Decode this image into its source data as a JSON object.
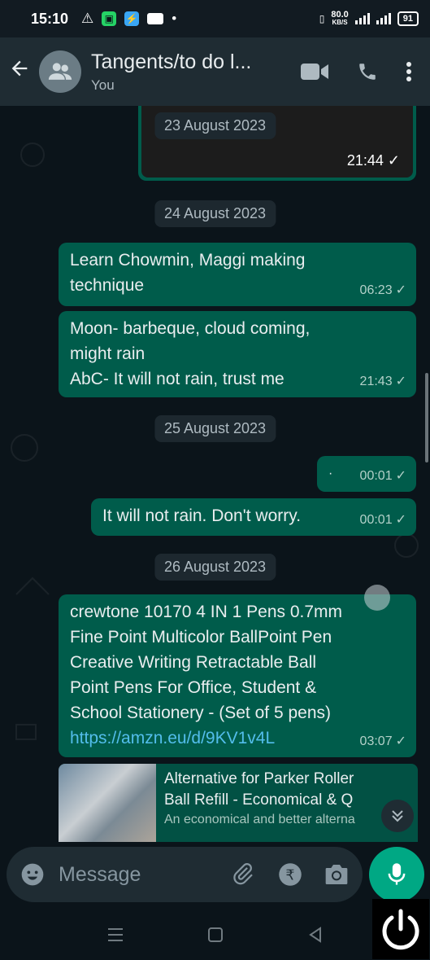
{
  "status_bar": {
    "time": "15:10",
    "speed": "80.0",
    "speed_unit": "KB/S",
    "battery": "91"
  },
  "header": {
    "title": "Tangents/to do l...",
    "subtitle": "You"
  },
  "messages": {
    "m0_time": "21:44",
    "date1": "23 August 2023",
    "date2": "24 August 2023",
    "m1_line1": "Learn Chowmin, Maggi making",
    "m1_line2": "technique",
    "m1_time": "06:23",
    "m2_line1": "Moon- barbeque, cloud coming,",
    "m2_line2": "might rain",
    "m2_line3": "AbC- It will not rain, trust me",
    "m2_time": "21:43",
    "date3": "25 August 2023",
    "m3_text": "·",
    "m3_time": "00:01",
    "m4_text": "It will not rain. Don't worry.",
    "m4_time": "00:01",
    "date4": "26 August 2023",
    "m5_line1": "crewtone 10170 4 IN 1 Pens 0.7mm",
    "m5_line2": "Fine Point Multicolor BallPoint Pen",
    "m5_line3": "Creative Writing Retractable Ball",
    "m5_line4": "Point Pens For Office, Student &",
    "m5_line5": "School Stationery - (Set of 5 pens)",
    "m5_link": "https://amzn.eu/d/9KV1v4L",
    "m5_time": "03:07",
    "preview_title_1": "Alternative for Parker Roller",
    "preview_title_2": "Ball Refill - Economical & Q",
    "preview_desc": "An economical and better alterna"
  },
  "input": {
    "placeholder": "Message"
  }
}
